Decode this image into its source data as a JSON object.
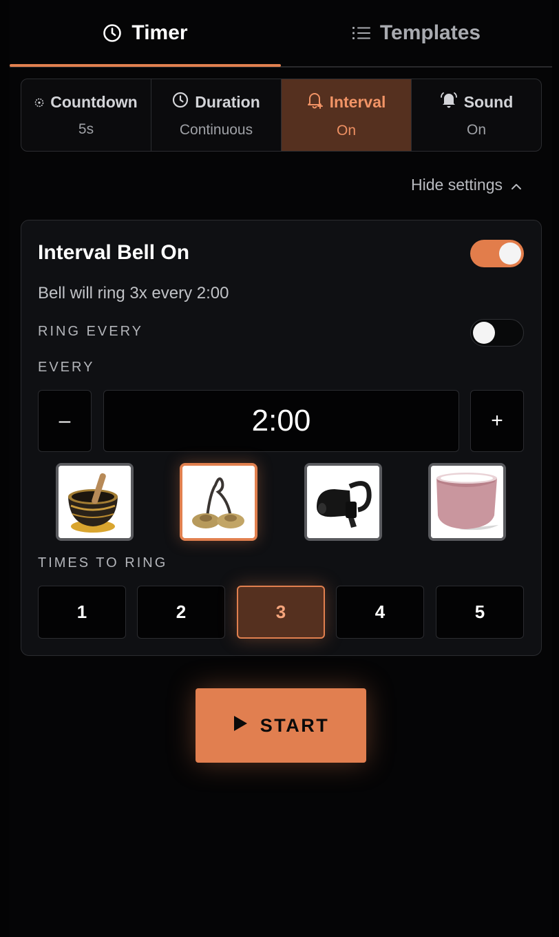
{
  "tabs": [
    {
      "label": "Timer",
      "icon": "clock-icon",
      "active": true
    },
    {
      "label": "Templates",
      "icon": "list-icon",
      "active": false
    }
  ],
  "settings": [
    {
      "title": "Countdown",
      "value": "5s",
      "icon": "countdown-icon"
    },
    {
      "title": "Duration",
      "value": "Continuous",
      "icon": "clock-icon"
    },
    {
      "title": "Interval",
      "value": "On",
      "icon": "bell-plus-icon"
    },
    {
      "title": "Sound",
      "value": "On",
      "icon": "bell-icon"
    }
  ],
  "hide_settings_label": "Hide settings",
  "interval": {
    "title": "Interval Bell On",
    "enabled": true,
    "description": "Bell will ring 3x every 2:00",
    "ring_every_label": "RING EVERY",
    "ring_every_enabled": false,
    "every_label": "EVERY",
    "decrement_label": "–",
    "increment_label": "+",
    "time_value": "2:00",
    "bells": [
      "singing-bowl",
      "tingsha-cymbals",
      "bicycle-bell",
      "crystal-bowl"
    ],
    "selected_bell": "tingsha-cymbals",
    "times_label": "TIMES TO RING",
    "times_options": [
      "1",
      "2",
      "3",
      "4",
      "5"
    ],
    "times_selected": "3"
  },
  "start_label": "START",
  "colors": {
    "accent": "#e1804f",
    "active_bg": "#55301f",
    "background": "#050506"
  }
}
